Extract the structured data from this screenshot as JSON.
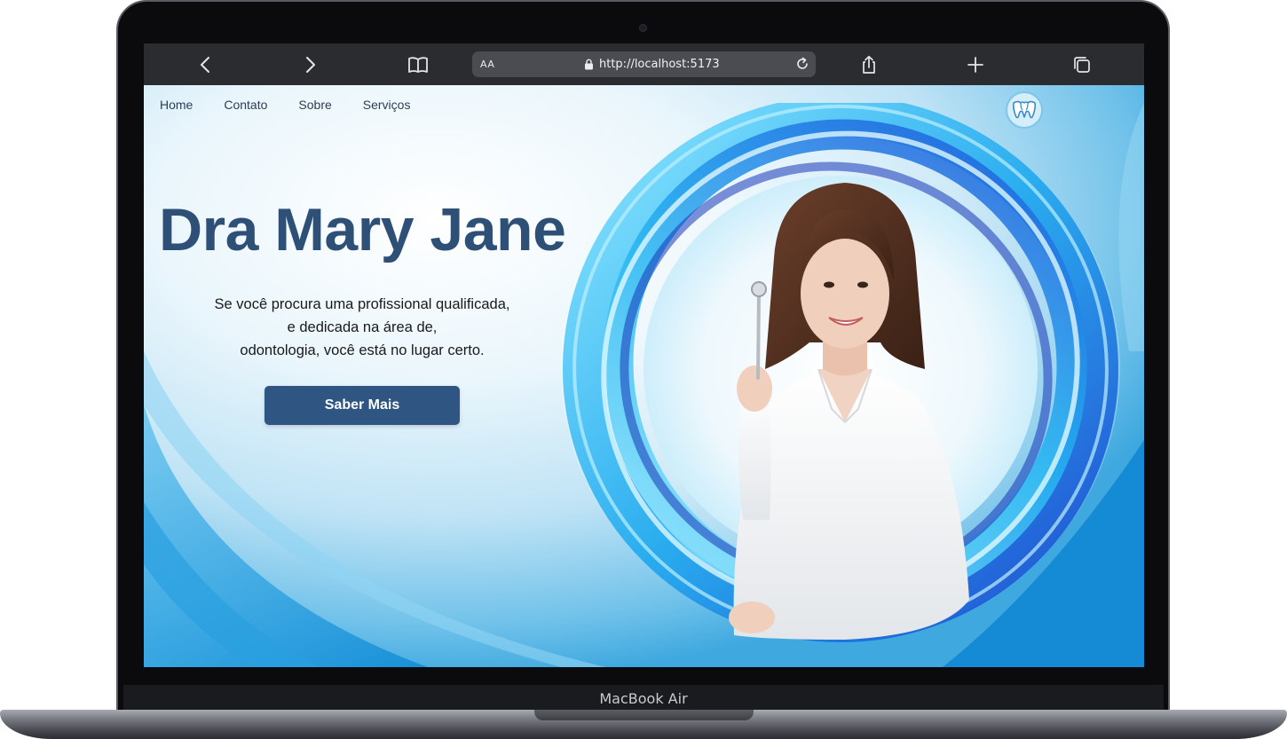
{
  "browser": {
    "reader_label": "AA",
    "url": "http://localhost:5173"
  },
  "nav": {
    "items": [
      {
        "label": "Home"
      },
      {
        "label": "Contato"
      },
      {
        "label": "Sobre"
      },
      {
        "label": "Serviços"
      }
    ]
  },
  "hero": {
    "title": "Dra Mary Jane",
    "description_lines": [
      "Se você procura uma profissional qualificada,",
      "e dedicada na área de,",
      "odontologia, você está no lugar certo."
    ],
    "cta_label": "Saber Mais"
  },
  "device": {
    "label": "MacBook Air"
  },
  "colors": {
    "title": "#2e5077",
    "button": "#2f5583",
    "toolbar": "#2a2c30",
    "swirl_accent": "#1e8fe0"
  },
  "icons": [
    "back-icon",
    "forward-icon",
    "book-icon",
    "lock-icon",
    "reload-icon",
    "share-icon",
    "plus-icon",
    "tabs-icon",
    "tooth-logo-icon"
  ]
}
